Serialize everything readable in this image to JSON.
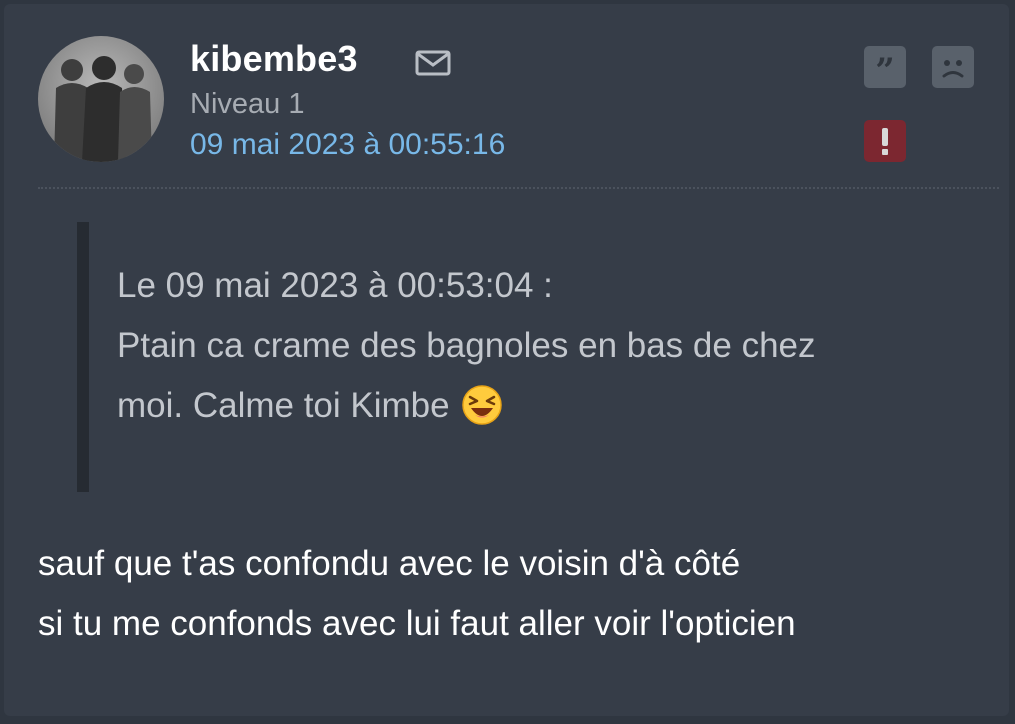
{
  "post": {
    "author": {
      "username": "kibembe3",
      "level": "Niveau 1",
      "avatar_icon": "group-silhouette-avatar"
    },
    "date": "09 mai 2023 à 00:55:16",
    "actions": {
      "message_icon": "envelope-icon",
      "quote_icon": "quote-icon",
      "sad_icon": "sad-face-icon",
      "report_icon": "exclamation-icon"
    },
    "quote": {
      "header": "Le 09 mai 2023 à 00:53:04 :",
      "line1": "Ptain ca crame des bagnoles en bas de chez",
      "line2": "moi. Calme toi Kimbe",
      "emoji": "laughing-face-emoji"
    },
    "body": {
      "line1": "sauf que t'as confondu avec le voisin d'à côté",
      "line2": "si tu me confonds avec lui faut aller voir l'opticien"
    },
    "colors": {
      "background": "#363d48",
      "username": "#ffffff",
      "date_link": "#78b8e8",
      "report_button": "#7c2730",
      "action_button": "#59616b"
    }
  }
}
